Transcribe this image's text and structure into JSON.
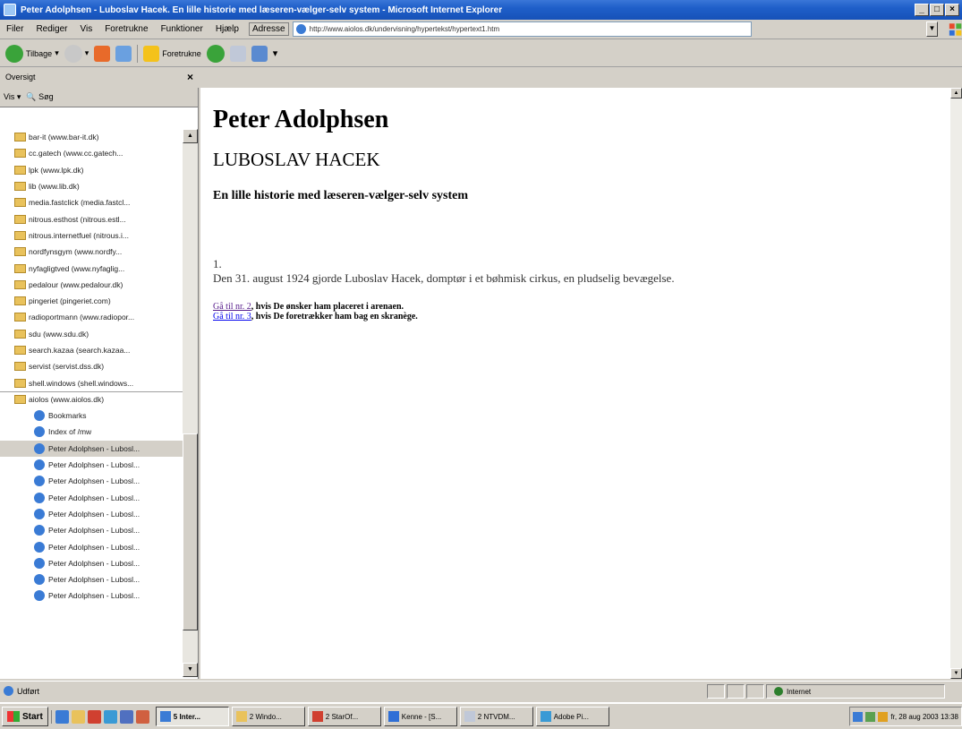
{
  "window": {
    "title": "Peter Adolphsen - Luboslav Hacek. En lille historie med læseren-vælger-selv system - Microsoft Internet Explorer",
    "minimize": "_",
    "maximize": "□",
    "close": "×"
  },
  "menu": {
    "items": [
      "Filer",
      "Rediger",
      "Vis",
      "Foretrukne",
      "Funktioner",
      "Hjælp"
    ],
    "address_label": "Adresse",
    "address_value": "http://www.aiolos.dk/undervisning/hypertekst/hypertext1.htm"
  },
  "toolbar": {
    "back": "Tilbage",
    "favorites": "Foretrukne"
  },
  "sidebar": {
    "header": "Oversigt",
    "close": "×",
    "view_label": "Vis",
    "search_label": "Søg",
    "items": [
      {
        "label": "bar-it (www.bar-it.dk)",
        "kind": "folder"
      },
      {
        "label": "cc.gatech (www.cc.gatech...",
        "kind": "folder"
      },
      {
        "label": "lpk (www.lpk.dk)",
        "kind": "folder"
      },
      {
        "label": "lib (www.lib.dk)",
        "kind": "folder"
      },
      {
        "label": "media.fastclick (media.fastcl...",
        "kind": "folder"
      },
      {
        "label": "nitrous.esthost (nitrous.estl...",
        "kind": "folder"
      },
      {
        "label": "nitrous.internetfuel (nitrous.i...",
        "kind": "folder"
      },
      {
        "label": "nordfynsgym (www.nordfy...",
        "kind": "folder"
      },
      {
        "label": "nyfagligtved (www.nyfaglig...",
        "kind": "folder"
      },
      {
        "label": "pedalour (www.pedalour.dk)",
        "kind": "folder"
      },
      {
        "label": "pingeriet (pingeriet.com)",
        "kind": "folder"
      },
      {
        "label": "radioportmann (www.radiopor...",
        "kind": "folder"
      },
      {
        "label": "sdu (www.sdu.dk)",
        "kind": "folder"
      },
      {
        "label": "search.kazaa (search.kazaa...",
        "kind": "folder"
      },
      {
        "label": "servist (servist.dss.dk)",
        "kind": "folder"
      },
      {
        "label": "shell.windows (shell.windows...",
        "kind": "folder"
      },
      {
        "label": "aiolos (www.aiolos.dk)",
        "kind": "folder-open"
      },
      {
        "label": "Bookmarks",
        "kind": "page"
      },
      {
        "label": "Index of /mw",
        "kind": "page"
      },
      {
        "label": "Peter Adolphsen - Lubosl...",
        "kind": "page",
        "selected": true
      },
      {
        "label": "Peter Adolphsen - Lubosl...",
        "kind": "page"
      },
      {
        "label": "Peter Adolphsen - Lubosl...",
        "kind": "page"
      },
      {
        "label": "Peter Adolphsen - Lubosl...",
        "kind": "page"
      },
      {
        "label": "Peter Adolphsen - Lubosl...",
        "kind": "page"
      },
      {
        "label": "Peter Adolphsen - Lubosl...",
        "kind": "page"
      },
      {
        "label": "Peter Adolphsen - Lubosl...",
        "kind": "page"
      },
      {
        "label": "Peter Adolphsen - Lubosl...",
        "kind": "page"
      },
      {
        "label": "Peter Adolphsen - Lubosl...",
        "kind": "page"
      },
      {
        "label": "Peter Adolphsen - Lubosl...",
        "kind": "page"
      }
    ]
  },
  "page": {
    "author": "Peter Adolphsen",
    "heading": "LUBOSLAV HACEK",
    "subtitle": "En lille historie med læseren-vælger-selv system",
    "chapter": "1.",
    "paragraph": "Den 31. august 1924 gjorde Luboslav Hacek, domptør i et bøhmisk cirkus, en pludselig bevægelse.",
    "links": [
      {
        "link": "Gå til nr. 2",
        "rest": ", hvis De ønsker ham placeret i arenaen."
      },
      {
        "link": "Gå til nr. 3",
        "rest": ", hvis De foretrækker ham bag en skranège."
      }
    ]
  },
  "status": {
    "text": "Udført",
    "zone": "Internet"
  },
  "taskbar": {
    "start": "Start",
    "tasks": [
      "5 Inter...",
      "2 Windo...",
      "2 StarOf...",
      "Kenne - [S...",
      "2 NTVDM...",
      "Adobe Pi..."
    ],
    "clock": "fr, 28 aug 2003  13:38"
  }
}
